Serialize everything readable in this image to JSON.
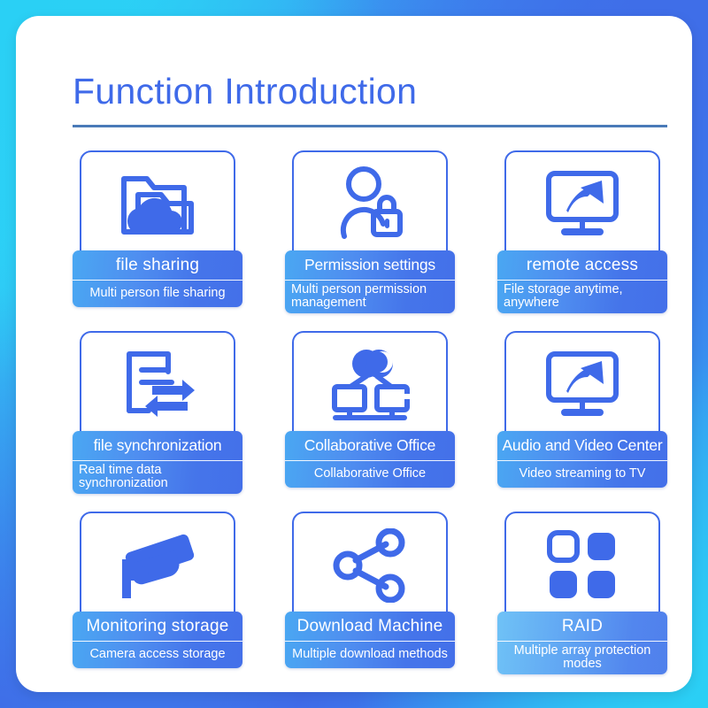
{
  "header": {
    "title": "Function Introduction",
    "accent_color": "#3f6ae9",
    "rule_color": "#4a7ab8"
  },
  "background": {
    "gradient_from": "#2ad0f5",
    "gradient_to": "#3f6ee8",
    "card_background": "#ffffff"
  },
  "cards": [
    {
      "icon": "folder-cloud-icon",
      "title": "file sharing",
      "subtitle": "Multi person file sharing",
      "subtitle_align": "center",
      "band_style": "normal",
      "title_fit": "normal"
    },
    {
      "icon": "person-lock-icon",
      "title": "Permission settings",
      "subtitle": "Multi person permission management",
      "subtitle_align": "left",
      "band_style": "normal",
      "title_fit": "tight"
    },
    {
      "icon": "monitor-arrow-icon",
      "title": "remote access",
      "subtitle": "File storage anytime, anywhere",
      "subtitle_align": "left",
      "band_style": "normal",
      "title_fit": "normal"
    },
    {
      "icon": "document-sync-icon",
      "title": "file synchronization",
      "subtitle": "Real time data synchronization",
      "subtitle_align": "left",
      "band_style": "normal",
      "title_fit": "tight"
    },
    {
      "icon": "collaboration-network-icon",
      "title": "Collaborative Office",
      "subtitle": "Collaborative Office",
      "subtitle_align": "center",
      "band_style": "normal",
      "title_fit": "tight"
    },
    {
      "icon": "monitor-arrow-icon",
      "title": "Audio and Video Center",
      "subtitle": "Video streaming to TV",
      "subtitle_align": "center",
      "band_style": "normal",
      "title_fit": "tight"
    },
    {
      "icon": "cctv-camera-icon",
      "title": "Monitoring storage",
      "subtitle": "Camera access storage",
      "subtitle_align": "center",
      "band_style": "normal",
      "title_fit": "normal"
    },
    {
      "icon": "share-nodes-icon",
      "title": "Download Machine",
      "subtitle": "Multiple download methods",
      "subtitle_align": "center",
      "band_style": "normal",
      "title_fit": "normal"
    },
    {
      "icon": "raid-squares-icon",
      "title": "RAID",
      "subtitle": "Multiple array protection modes",
      "subtitle_align": "center",
      "band_style": "light",
      "title_fit": "normal"
    }
  ]
}
